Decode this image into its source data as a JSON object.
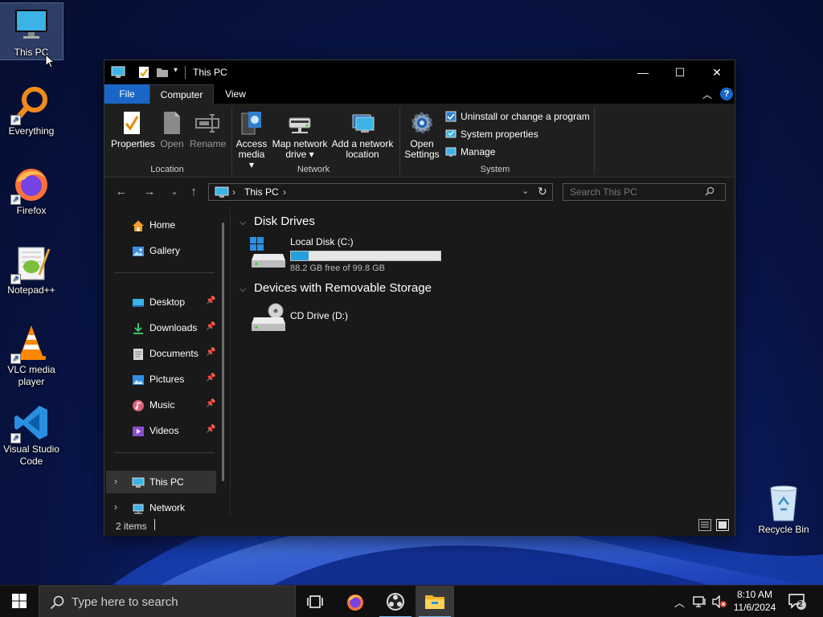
{
  "desktop": {
    "icons": [
      {
        "label": "This PC",
        "icon": "monitor-icon"
      },
      {
        "label": "Everything",
        "icon": "magnifier-icon"
      },
      {
        "label": "Firefox",
        "icon": "firefox-icon"
      },
      {
        "label": "Notepad++",
        "icon": "notepadpp-icon"
      },
      {
        "label": "VLC media player",
        "icon": "vlc-cone-icon"
      },
      {
        "label": "Visual Studio Code",
        "icon": "vscode-icon"
      },
      {
        "label": "Recycle Bin",
        "icon": "recycle-bin-icon"
      }
    ]
  },
  "window": {
    "title": "This PC",
    "controls": {
      "minimize": "—",
      "maximize": "☐",
      "close": "✕"
    },
    "tabs": {
      "file": "File",
      "computer": "Computer",
      "view": "View"
    },
    "help": "?",
    "ribbon": {
      "location": {
        "label": "Location",
        "buttons": [
          "Properties",
          "Open",
          "Rename"
        ]
      },
      "network": {
        "label": "Network",
        "access_media": [
          "Access",
          "media ▾"
        ],
        "map_drive": [
          "Map network",
          "drive ▾"
        ],
        "add_location": [
          "Add a network",
          "location"
        ]
      },
      "system": {
        "label": "System",
        "open_settings": [
          "Open",
          "Settings"
        ],
        "uninstall": "Uninstall or change a program",
        "system_properties": "System properties",
        "manage": "Manage"
      }
    },
    "address": {
      "crumb": "This PC",
      "search_placeholder": "Search This PC"
    },
    "nav": {
      "home": "Home",
      "gallery": "Gallery",
      "pinned": [
        {
          "label": "Desktop",
          "icon": "desktop-folder-icon"
        },
        {
          "label": "Downloads",
          "icon": "download-arrow-icon"
        },
        {
          "label": "Documents",
          "icon": "documents-icon"
        },
        {
          "label": "Pictures",
          "icon": "pictures-icon"
        },
        {
          "label": "Music",
          "icon": "music-note-icon"
        },
        {
          "label": "Videos",
          "icon": "videos-icon"
        }
      ],
      "this_pc": "This PC",
      "network": "Network"
    },
    "content": {
      "sections": {
        "disk_drives": "Disk Drives",
        "removable": "Devices with Removable Storage"
      },
      "drives": {
        "c": {
          "name": "Local Disk (C:)",
          "free_text": "88.2 GB free of 99.8 GB",
          "used_fraction": 0.116
        },
        "d": {
          "name": "CD Drive (D:)"
        }
      }
    },
    "status": {
      "count": "2 items"
    }
  },
  "taskbar": {
    "search_placeholder": "Type here to search",
    "apps": [
      "task-view-icon",
      "firefox-icon",
      "obs-icon",
      "file-explorer-icon"
    ],
    "clock": {
      "time": "8:10 AM",
      "date": "11/6/2024"
    },
    "notifications": "2"
  },
  "colors": {
    "accent": "#1a66c8",
    "progress": "#26a0da",
    "window_bg": "#191919",
    "titlebar": "#000000"
  }
}
